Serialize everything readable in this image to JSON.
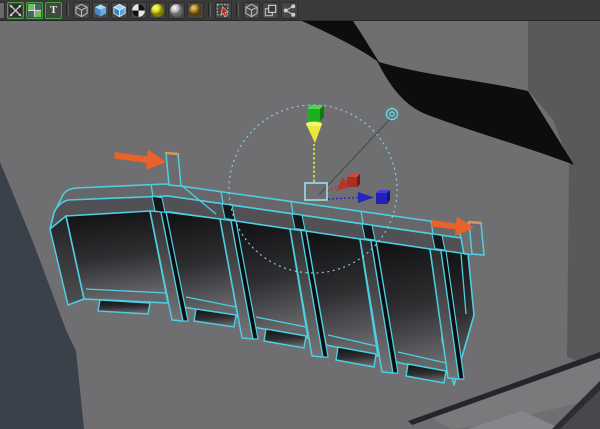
{
  "window": {
    "title": "3D viewport",
    "kind": "polygon modeling view"
  },
  "toolbar": {
    "icons": [
      {
        "name": "clipped-left-icon",
        "type": "partial",
        "active": false
      },
      {
        "name": "quad-view-icon",
        "type": "quadview",
        "active": true
      },
      {
        "name": "split-view-icon",
        "type": "splitview",
        "active": true
      },
      {
        "name": "text-tool-icon",
        "type": "text",
        "active": true,
        "glyph": "T"
      },
      {
        "type": "sep"
      },
      {
        "name": "wireframe-mode-icon",
        "type": "cubewire",
        "active": false
      },
      {
        "name": "shaded-mode-icon",
        "type": "cubesolid",
        "active": false
      },
      {
        "name": "wireframe-on-shaded-icon",
        "type": "cubewiresolid",
        "active": false
      },
      {
        "name": "textured-mode-icon",
        "type": "spherechecker",
        "active": false
      },
      {
        "name": "lighting-icon",
        "type": "sphereyellow",
        "active": false
      },
      {
        "name": "default-material-icon",
        "type": "spheregray",
        "active": false
      },
      {
        "name": "material-icon",
        "type": "spheregold",
        "active": false
      },
      {
        "type": "sep"
      },
      {
        "name": "isolate-select-icon",
        "type": "isolate",
        "active": false
      },
      {
        "type": "sep"
      },
      {
        "name": "xray-mode-icon",
        "type": "cubewire",
        "active": false
      },
      {
        "name": "backface-culling-icon",
        "type": "doublesquare",
        "active": false
      },
      {
        "name": "joint-xray-icon",
        "type": "share",
        "active": false
      }
    ]
  },
  "scene": {
    "selected_object": "wireframe panel strip",
    "active_tool": "move-manipulator",
    "annotation_arrows": 2,
    "highlighted_edges": 2
  },
  "colors": {
    "wireframe": "#4ccfe0",
    "highlight_edge": "#cf9a5e",
    "annotation_arrow": "#e8622a",
    "axis_x": "#b8352b",
    "axis_y": "#e8e838",
    "axis_y_cube": "#1fae1f",
    "axis_z": "#2626c4",
    "manipulator_circle": "#86dcea",
    "viewport_bg": "#6f6f72",
    "toolbar_bg": "#3a3a3a"
  }
}
